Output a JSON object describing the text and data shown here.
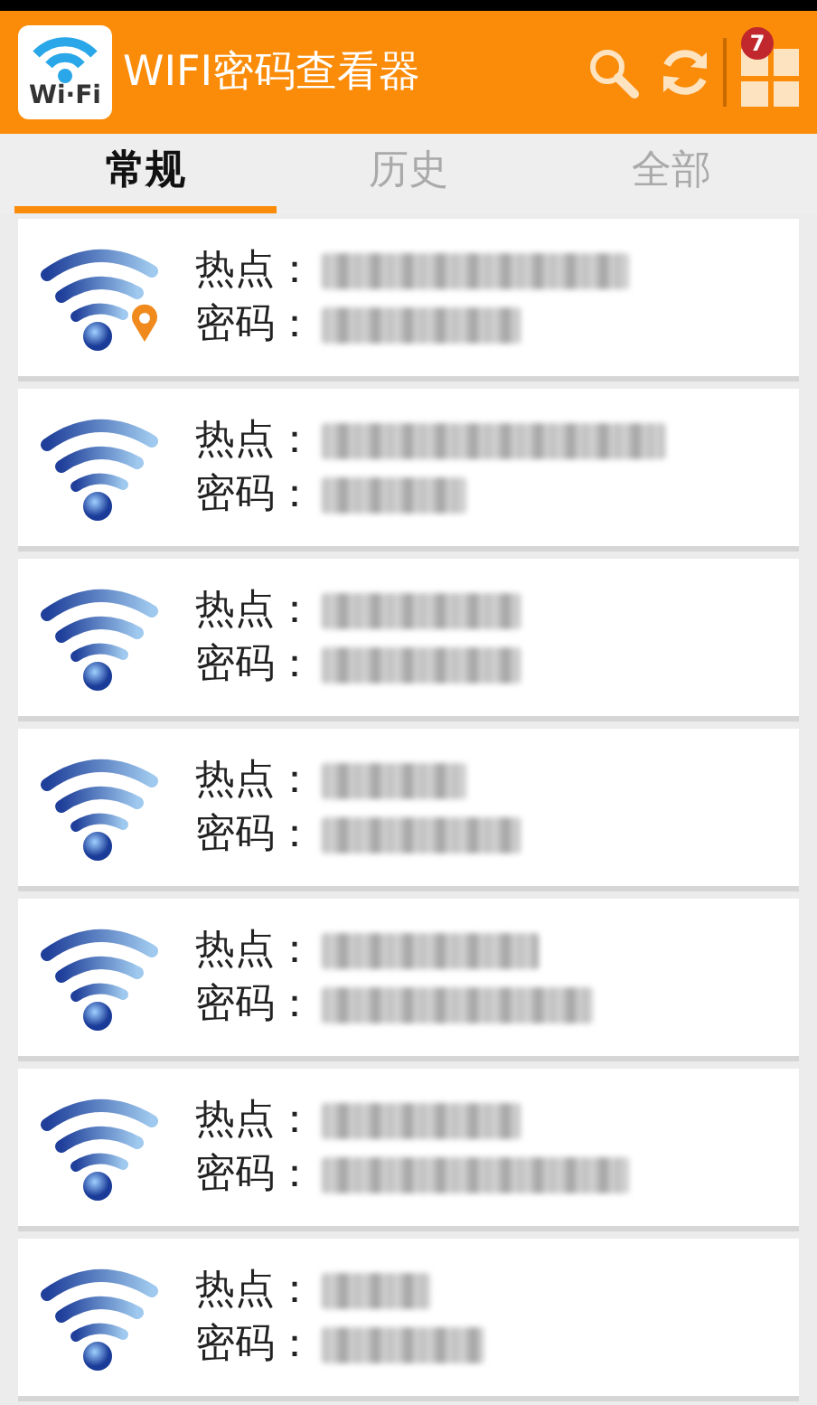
{
  "app_bar": {
    "title": "WIFI密码查看器",
    "logo_text": "Wi·Fi",
    "badge": "7"
  },
  "tabs": [
    {
      "label": "常规",
      "selected": true
    },
    {
      "label": "历史",
      "selected": false
    },
    {
      "label": "全部",
      "selected": false
    }
  ],
  "networks": [
    {
      "hotspot_label": "热点：",
      "password_label": "密码：",
      "location": true,
      "hotspot_blurred": true,
      "password_blurred": true
    },
    {
      "hotspot_label": "热点：",
      "password_label": "密码：",
      "location": false,
      "hotspot_blurred": true,
      "password_blurred": true
    },
    {
      "hotspot_label": "热点：",
      "password_label": "密码：",
      "location": false,
      "hotspot_blurred": true,
      "password_blurred": true
    },
    {
      "hotspot_label": "热点：",
      "password_label": "密码：",
      "location": false,
      "hotspot_blurred": true,
      "password_blurred": true
    },
    {
      "hotspot_label": "热点：",
      "password_label": "密码：",
      "location": false,
      "hotspot_blurred": true,
      "password_blurred": true
    },
    {
      "hotspot_label": "热点：",
      "password_label": "密码：",
      "location": false,
      "hotspot_blurred": true,
      "password_blurred": true
    },
    {
      "hotspot_label": "热点：",
      "password_label": "密码：",
      "location": false,
      "hotspot_blurred": true,
      "password_blurred": true
    }
  ]
}
